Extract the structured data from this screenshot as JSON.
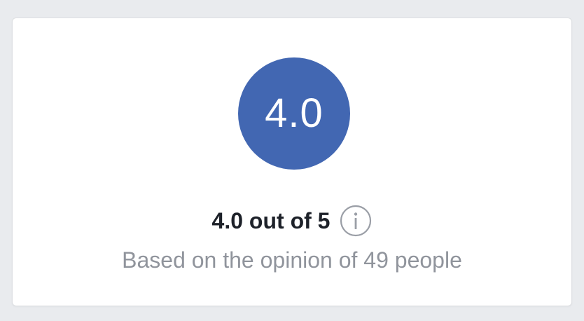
{
  "rating": {
    "score": "4.0",
    "summary": "4.0 out of 5",
    "basis": "Based on the opinion of 49 people",
    "value": 4.0,
    "max": 5,
    "reviewer_count": 49
  },
  "icons": {
    "info": "info-icon"
  },
  "colors": {
    "accent": "#4267b2",
    "page_background": "#e9ebee",
    "card_background": "#ffffff",
    "primary_text": "#1d2129",
    "secondary_text": "#90949c"
  }
}
